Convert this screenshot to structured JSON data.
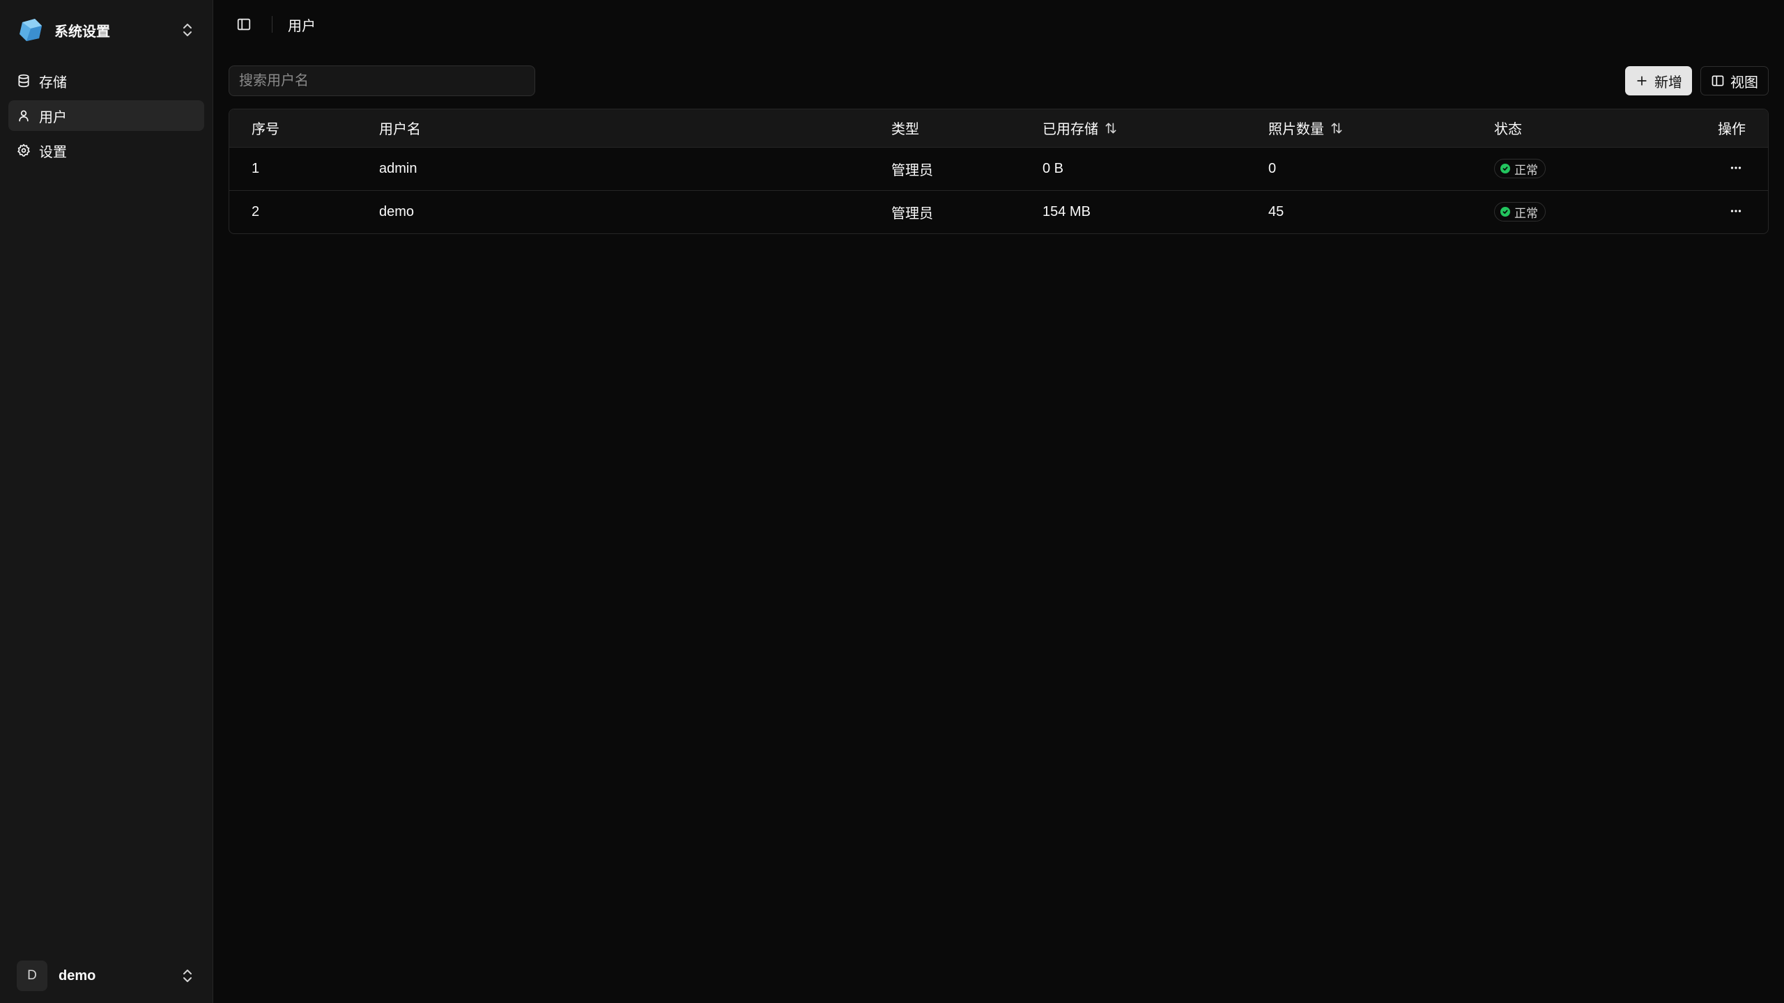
{
  "colors": {
    "background": "#0a0a0a",
    "sidebar_bg": "#171717",
    "active_item_bg": "#262626",
    "status_ok": "#22c55e",
    "logo_blue": "#4a9fdc"
  },
  "sidebar": {
    "title": "系统设置",
    "logo_icon": "cube-logo-icon",
    "items": [
      {
        "label": "存储",
        "icon": "database-icon",
        "active": false
      },
      {
        "label": "用户",
        "icon": "user-icon",
        "active": true
      },
      {
        "label": "设置",
        "icon": "gear-icon",
        "active": false
      }
    ],
    "footer": {
      "avatar_initial": "D",
      "user_name": "demo"
    }
  },
  "topbar": {
    "breadcrumb": "用户"
  },
  "toolbar": {
    "search_placeholder": "搜索用户名",
    "add_label": "新增",
    "view_label": "视图"
  },
  "table": {
    "headers": {
      "index": "序号",
      "username": "用户名",
      "type": "类型",
      "storage": "已用存储",
      "photos": "照片数量",
      "status": "状态",
      "actions": "操作"
    },
    "rows": [
      {
        "index": "1",
        "username": "admin",
        "type": "管理员",
        "storage": "0 B",
        "photos": "0",
        "status": "正常"
      },
      {
        "index": "2",
        "username": "demo",
        "type": "管理员",
        "storage": "154 MB",
        "photos": "45",
        "status": "正常"
      }
    ]
  }
}
